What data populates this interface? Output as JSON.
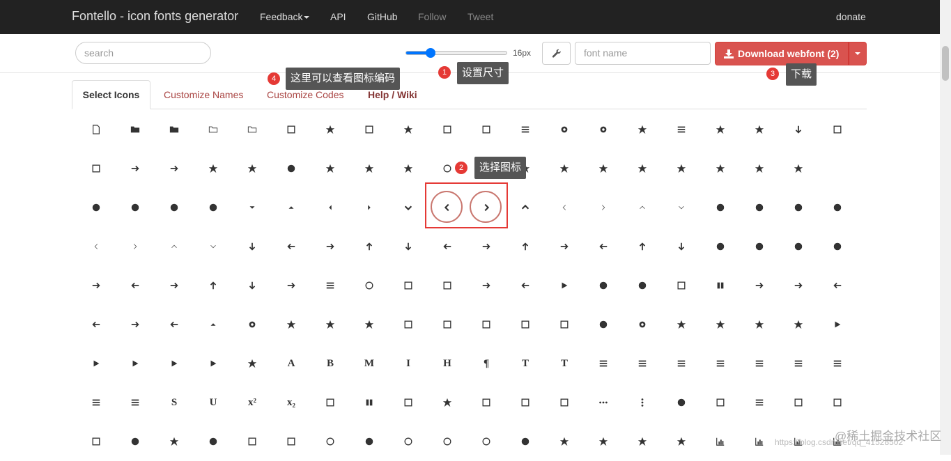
{
  "nav": {
    "brand": "Fontello - icon fonts generator",
    "feedback": "Feedback",
    "api": "API",
    "github": "GitHub",
    "follow": "Follow",
    "tweet": "Tweet",
    "donate": "donate"
  },
  "toolbar": {
    "search_placeholder": "search",
    "size_label": "16px",
    "size_value": 16,
    "fontname_placeholder": "font name",
    "download_label": "Download webfont (2)"
  },
  "tabs": [
    "Select Icons",
    "Customize Names",
    "Customize Codes",
    "Help / Wiki"
  ],
  "annotations": {
    "a1_num": "1",
    "a1_text": "设置尺寸",
    "a2_num": "2",
    "a2_text": "选择图标",
    "a3_num": "3",
    "a3_text": "下载",
    "a4_num": "4",
    "a4_text": "这里可以查看图标编码"
  },
  "watermark": "https://blog.csdn.net/qq_41528502",
  "watermark2": "@稀土掘金技术社区",
  "icon_rows": [
    [
      "code-icon",
      "folder-icon",
      "folder-open-icon",
      "folder-outline-icon",
      "folder-open-outline-icon",
      "archive-icon",
      "rss-icon",
      "rss-square-icon",
      "phone-icon",
      "phone-square-icon",
      "fax-icon",
      "menu-icon",
      "cog-icon",
      "cogs-icon",
      "wrench-icon",
      "sliders-icon",
      "cart-icon",
      "cart-plus-icon",
      "cart-arrow-down-icon",
      "calendar-icon"
    ],
    [
      "calendar-empty-icon",
      "login-icon",
      "logout-icon",
      "mic-icon",
      "mute-icon",
      "volume-off-icon",
      "volume-down-icon",
      "volume-up-icon",
      "headphones-icon",
      "clock-icon",
      "block-icon",
      "resize-full-icon",
      "resize-full-alt-icon",
      "resize-small-icon",
      "resize-vertical-icon",
      "resize-horizontal-icon",
      "move-icon",
      "zoom-in-icon",
      "zoom-out-icon"
    ],
    [
      "down-circled-icon",
      "up-circled-icon",
      "left-circled-icon",
      "right-circled-icon",
      "down-dir-icon",
      "up-dir-icon",
      "left-dir-icon",
      "right-dir-icon",
      "down-open-icon",
      "left-open-icon",
      "right-open-icon",
      "up-open-icon",
      "angle-left-icon",
      "angle-right-icon",
      "angle-up-icon",
      "angle-down-icon",
      "angle-circled-left-icon",
      "angle-circled-right-icon",
      "angle-circled-up-icon",
      "angle-circled-down-icon"
    ],
    [
      "angle-double-left-icon",
      "angle-double-right-icon",
      "angle-double-up-icon",
      "angle-double-down-icon",
      "down-icon",
      "left-icon",
      "right-icon",
      "up-icon",
      "down-big-icon",
      "left-big-icon",
      "right-big-icon",
      "up-big-icon",
      "right-hand-icon",
      "left-hand-icon",
      "up-hand-icon",
      "down-hand-icon",
      "left-circled2-icon",
      "right-circled2-icon",
      "up-circled2-icon",
      "down-circled2-icon"
    ],
    [
      "cw-icon",
      "ccw-icon",
      "arrows-cw-icon",
      "level-up-icon",
      "level-down-icon",
      "shuffle-icon",
      "exchange-icon",
      "history-icon",
      "expand-icon",
      "collapse-icon",
      "expand-right-icon",
      "collapse-left-icon",
      "play-icon",
      "play-circled-icon",
      "play-circled2-icon",
      "stop-icon",
      "pause-icon",
      "to-end-icon",
      "to-end-alt-icon",
      "to-start-icon"
    ],
    [
      "to-start-alt-icon",
      "fast-fw-icon",
      "fast-bw-icon",
      "eject-icon",
      "target-icon",
      "signal-icon",
      "wifi-icon",
      "award-icon",
      "desktop-icon",
      "laptop-icon",
      "tablet-icon",
      "mobile-icon",
      "inbox-icon",
      "globe-icon",
      "sun-icon",
      "cloud-icon",
      "flash-icon",
      "moon-icon",
      "umbrella-icon",
      "flight-icon"
    ],
    [
      "fighter-jet-icon",
      "paper-plane-icon",
      "paper-plane-empty-icon",
      "space-shuttle-icon",
      "leaf-icon",
      "font-icon",
      "bold-icon",
      "medium-icon",
      "italic-icon",
      "header-icon",
      "paragraph-icon",
      "text-height-icon",
      "text-width-icon",
      "align-left-icon",
      "align-center-icon",
      "align-right-icon",
      "align-justify-icon",
      "list-icon",
      "indent-left-icon",
      "indent-right-icon"
    ],
    [
      "list-bullet-icon",
      "list-numbered-icon",
      "strike-icon",
      "underline-icon",
      "superscript-icon",
      "subscript-icon",
      "table-icon",
      "columns-icon",
      "crop-icon",
      "scissors-icon",
      "paste-icon",
      "briefcase-icon",
      "suitcase-icon",
      "ellipsis-icon",
      "ellipsis-vert-icon",
      "off-icon",
      "road-icon",
      "list-alt-icon",
      "qrcode-icon",
      "barcode-icon"
    ],
    [
      "book-icon",
      "adjust-icon",
      "tint-icon",
      "toggle-off-icon",
      "toggle-on-icon",
      "check-icon",
      "check-empty-icon",
      "circle-icon",
      "circle-empty-icon",
      "circle-thin-icon",
      "circle-notch-icon",
      "dot-circled-icon",
      "asterisk-icon",
      "gift-icon",
      "fire-icon",
      "magnet-icon",
      "chart-bar-icon",
      "chart-area-icon",
      "chart-pie-icon",
      "chart-line-icon"
    ]
  ]
}
